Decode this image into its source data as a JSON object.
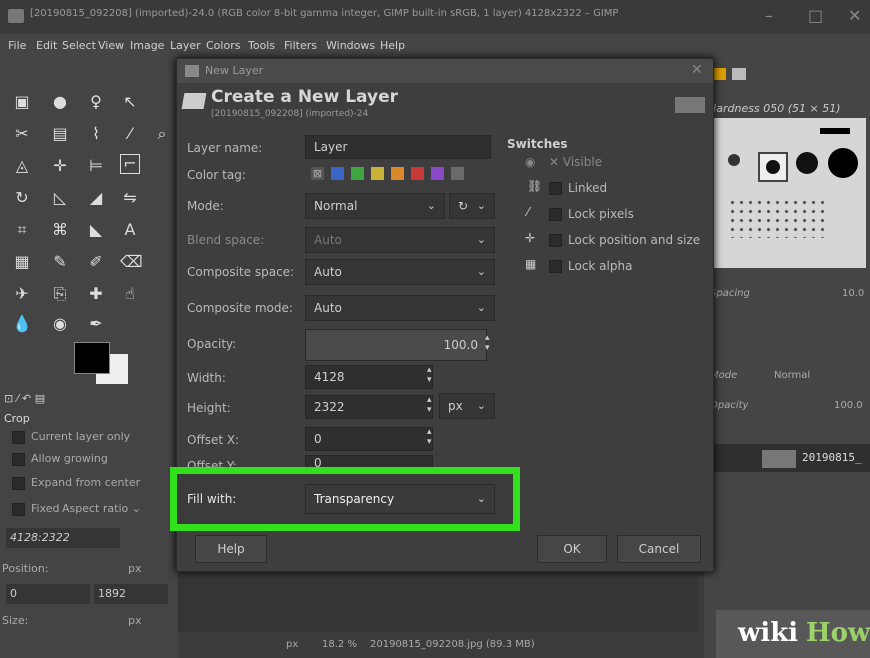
{
  "window": {
    "title": "[20190815_092208] (imported)-24.0 (RGB color 8-bit gamma integer, GIMP built-in sRGB, 1 layer) 4128x2322 – GIMP",
    "minimize": "–",
    "maximize": "□",
    "close": "✕"
  },
  "menu": [
    "File",
    "Edit",
    "Select",
    "View",
    "Image",
    "Layer",
    "Colors",
    "Tools",
    "Filters",
    "Windows",
    "Help"
  ],
  "tool_options": {
    "title": "Crop",
    "current_layer_only": "Current layer only",
    "allow_growing": "Allow growing",
    "expand_from_center": "Expand from center",
    "fixed": "Fixed",
    "aspect_ratio": "Aspect ratio",
    "ratio_value": "4128:2322",
    "position_label": "Position:",
    "position_unit": "px",
    "position_x": "0",
    "position_y": "1892",
    "size_label": "Size:",
    "size_unit": "px"
  },
  "dialog": {
    "window_title": "New Layer",
    "heading": "Create a New Layer",
    "subheading": "[20190815_092208] (imported)-24",
    "layer_name_label": "Layer name:",
    "layer_name_value": "Layer",
    "color_tag_label": "Color tag:",
    "color_tag_none": "⊠",
    "color_tags": [
      "#3a66c8",
      "#3ea63e",
      "#c8b23a",
      "#d88a2a",
      "#c83a3a",
      "#8a4ac8",
      "#6a6a6a"
    ],
    "mode_label": "Mode:",
    "mode_value": "Normal",
    "blend_space_label": "Blend space:",
    "blend_space_value": "Auto",
    "composite_space_label": "Composite space:",
    "composite_space_value": "Auto",
    "composite_mode_label": "Composite mode:",
    "composite_mode_value": "Auto",
    "opacity_label": "Opacity:",
    "opacity_value": "100.0",
    "width_label": "Width:",
    "width_value": "4128",
    "height_label": "Height:",
    "height_value": "2322",
    "unit_value": "px",
    "offset_x_label": "Offset X:",
    "offset_x_value": "0",
    "offset_y_label": "Offset Y:",
    "offset_y_value": "0",
    "fill_label": "Fill with:",
    "fill_value": "Transparency",
    "switches_title": "Switches",
    "switch_visible": "Visible",
    "switch_linked": "Linked",
    "switch_lock_pixels": "Lock pixels",
    "switch_lock_position": "Lock position and size",
    "switch_lock_alpha": "Lock alpha",
    "help_button": "Help",
    "ok_button": "OK",
    "cancel_button": "Cancel"
  },
  "right_dock": {
    "brush_title": "Hardness 050 (51 × 51)",
    "spacing_label": "Spacing",
    "spacing_value": "10.0",
    "mode_label": "Mode",
    "mode_value": "Normal",
    "opacity_label": "Opacity",
    "opacity_value": "100.0",
    "layer_name": "20190815_"
  },
  "status": {
    "unit": "px",
    "zoom": "18.2 %",
    "file": "20190815_092208.jpg (89.3 MB)"
  },
  "watermark": {
    "wiki": "wiki",
    "how": "How"
  },
  "colors": {
    "highlight": "#33e01c"
  }
}
